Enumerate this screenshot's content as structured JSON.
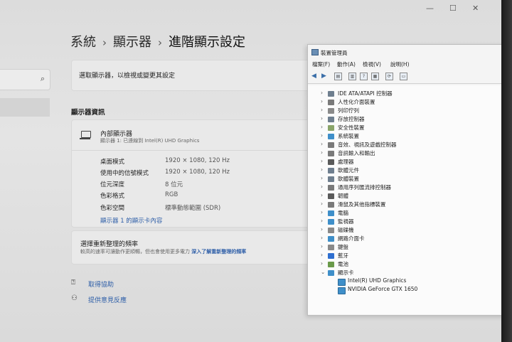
{
  "window": {
    "minimize": "—",
    "maximize": "☐",
    "close": "✕"
  },
  "sidebar": {
    "search_icon": "search-icon"
  },
  "breadcrumb": {
    "item1": "系統",
    "item2": "顯示器",
    "current": "進階顯示設定",
    "sep": "›"
  },
  "select_display": {
    "label": "選取顯示器，以檢視或變更其設定"
  },
  "display_info": {
    "section_title": "顯示器資訊",
    "monitor_name": "內部顯示器",
    "monitor_sub": "顯示器 1: 已連線到 Intel(R) UHD Graphics",
    "rows": [
      {
        "label": "桌面模式",
        "value": "1920 × 1080, 120 Hz"
      },
      {
        "label": "使用中的信號模式",
        "value": "1920 × 1080, 120 Hz"
      },
      {
        "label": "位元深度",
        "value": "8 位元"
      },
      {
        "label": "色彩格式",
        "value": "RGB"
      },
      {
        "label": "色彩空間",
        "value": "標準動態範圍 (SDR)"
      }
    ],
    "adapter_link": "顯示器 1 的顯示卡內容"
  },
  "refresh": {
    "title": "選擇重新整理的頻率",
    "subtitle": "較高的速率可讓動作更順暢，但也會使用更多電力",
    "link": "深入了解重新整理的頻率"
  },
  "help": [
    {
      "label": "取得協助"
    },
    {
      "label": "提供意見反應"
    }
  ],
  "device_manager": {
    "title": "裝置管理員",
    "menu": [
      "檔案(F)",
      "動作(A)",
      "檢視(V)",
      "說明(H)"
    ],
    "tree": [
      {
        "label": "IDE ATA/ATAPI 控制器",
        "color": "#6f7f8f"
      },
      {
        "label": "人性化介面裝置",
        "color": "#7a7a7a"
      },
      {
        "label": "列印佇列",
        "color": "#8a8a8a"
      },
      {
        "label": "存放控制器",
        "color": "#6f7f8f"
      },
      {
        "label": "安全性裝置",
        "color": "#8aa56a"
      },
      {
        "label": "系統裝置",
        "color": "#3f8fc9"
      },
      {
        "label": "音效、視訊及遊戲控制器",
        "color": "#7a7a7a"
      },
      {
        "label": "音訊輸入和輸出",
        "color": "#7a7a7a"
      },
      {
        "label": "處理器",
        "color": "#5a5a5a"
      },
      {
        "label": "軟體元件",
        "color": "#6f7f8f"
      },
      {
        "label": "軟體裝置",
        "color": "#6f7f8f"
      },
      {
        "label": "通用序列匯流排控制器",
        "color": "#7a7a7a"
      },
      {
        "label": "韌體",
        "color": "#5a5a5a"
      },
      {
        "label": "滑鼠及其他指標裝置",
        "color": "#7a7a7a"
      },
      {
        "label": "電腦",
        "color": "#3f8fc9"
      },
      {
        "label": "監視器",
        "color": "#3f8fc9"
      },
      {
        "label": "磁碟機",
        "color": "#8a8a8a"
      },
      {
        "label": "網路介面卡",
        "color": "#3f8fc9"
      },
      {
        "label": "鍵盤",
        "color": "#8a8a8a"
      },
      {
        "label": "藍牙",
        "color": "#2f6fd0"
      },
      {
        "label": "電池",
        "color": "#6a9a4a"
      },
      {
        "label": "顯示卡",
        "color": "#3f8fc9",
        "expanded": true
      }
    ],
    "children": [
      {
        "label": "Intel(R) UHD Graphics"
      },
      {
        "label": "NVIDIA GeForce GTX 1650"
      }
    ]
  }
}
